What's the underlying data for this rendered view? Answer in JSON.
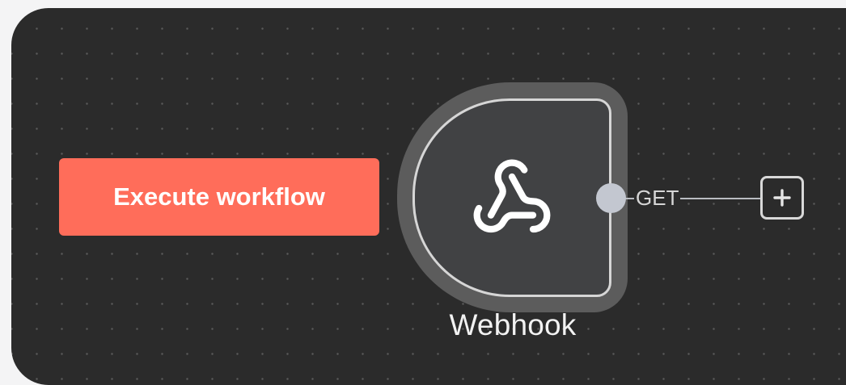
{
  "canvas": {
    "background_color": "#2b2b2b",
    "dot_color": "#5a5a5a"
  },
  "toolbar": {
    "execute_label": "Execute workflow",
    "execute_color": "#ff6d5a"
  },
  "node": {
    "name": "Webhook",
    "icon": "webhook-icon",
    "output_label": "GET"
  },
  "add_button": {
    "icon": "plus-icon"
  }
}
